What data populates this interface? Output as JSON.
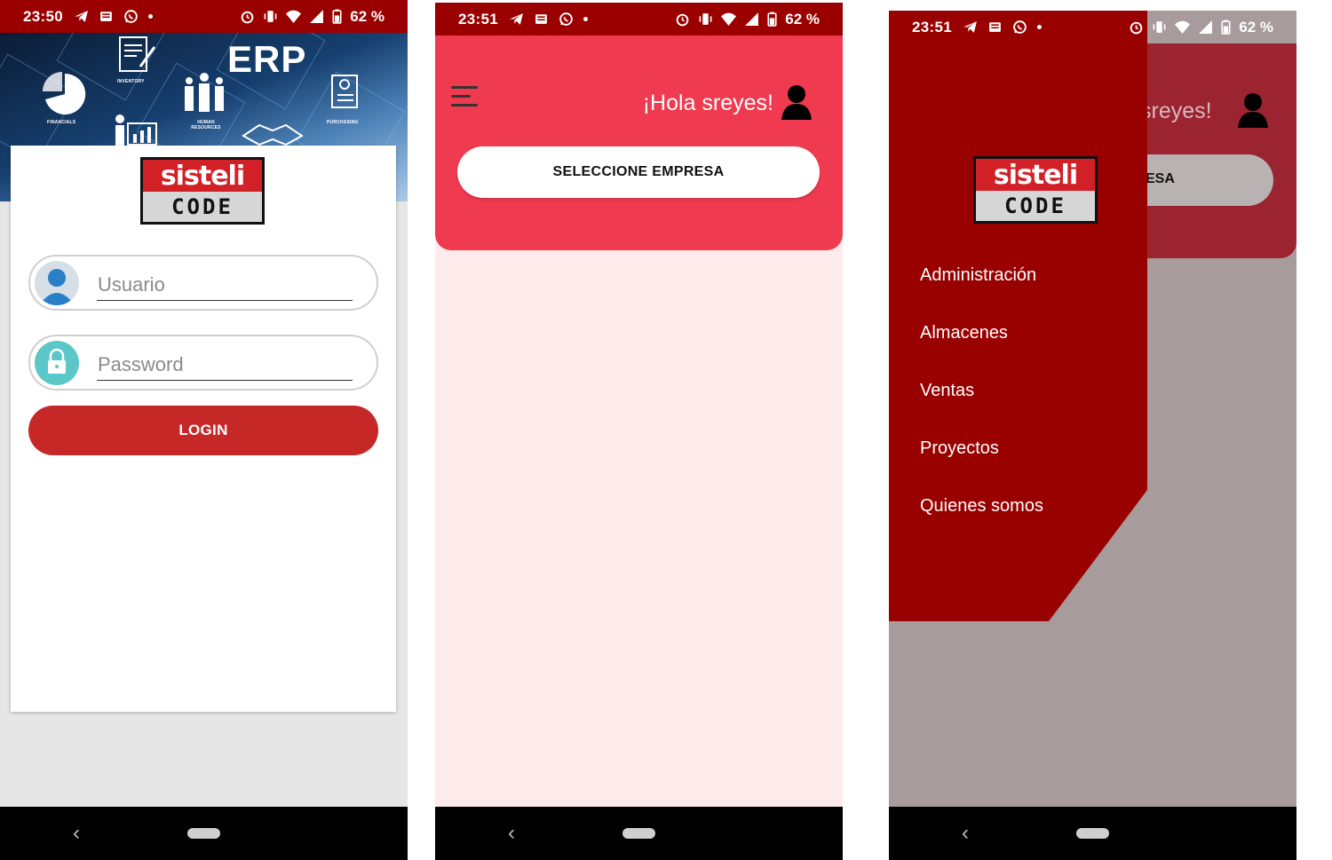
{
  "status_bar": {
    "screen1_time": "23:50",
    "screen2_time": "23:51",
    "screen3_time": "23:51",
    "battery": "62 %",
    "icons": [
      "telegram-icon",
      "news-icon",
      "whatsapp-icon",
      "notification-dot",
      "alarm-icon",
      "vibrate-icon",
      "wifi-icon",
      "signal-icon",
      "battery-icon"
    ]
  },
  "login_screen": {
    "banner": {
      "title": "ERP",
      "labels": [
        "FINANCIALS",
        "INVENTORY",
        "HUMAN RESOURCES",
        "PURCHASING"
      ]
    },
    "logo": {
      "top": "sisteli",
      "bottom": "CODE"
    },
    "username_placeholder": "Usuario",
    "password_placeholder": "Password",
    "login_label": "LOGIN"
  },
  "home_screen": {
    "greeting": "¡Hola sreyes!",
    "select_company_label": "SELECCIONE EMPRESA"
  },
  "drawer_screen": {
    "greeting_visible": "sreyes!",
    "select_visible": "ESA",
    "logo": {
      "top": "sisteli",
      "bottom": "CODE"
    },
    "menu_items": [
      "Administración",
      "Almacenes",
      "Ventas",
      "Proyectos",
      "Quienes somos"
    ]
  },
  "nav_bar": {
    "back_symbol": "‹"
  },
  "colors": {
    "status_bar": "#9a0000",
    "header": "#f03a4f",
    "login_button": "#c62828",
    "drawer": "#990000",
    "background_pink": "#fdeaea",
    "scrim": "#a79b9b"
  }
}
